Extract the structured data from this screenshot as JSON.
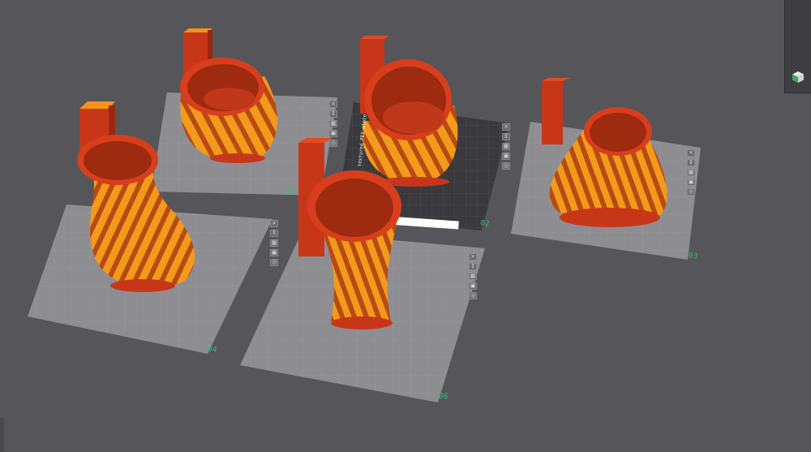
{
  "plates": [
    {
      "label": "01"
    },
    {
      "label": "02"
    },
    {
      "label": "03"
    },
    {
      "label": "04"
    },
    {
      "label": "05"
    },
    {
      "label": "06"
    }
  ],
  "active_plate_stamp": "textured PEI plate",
  "tool_icons": [
    "close-icon",
    "auto-orient-icon",
    "arrange-icon",
    "lock-icon",
    "settings-icon"
  ],
  "colors": {
    "background": "#56565a",
    "plate": "#8e8e92",
    "active_plate": "#3a3a3e",
    "model_orange": "#f59a1a",
    "model_red": "#d83e1c",
    "label_green": "#22c86a"
  }
}
